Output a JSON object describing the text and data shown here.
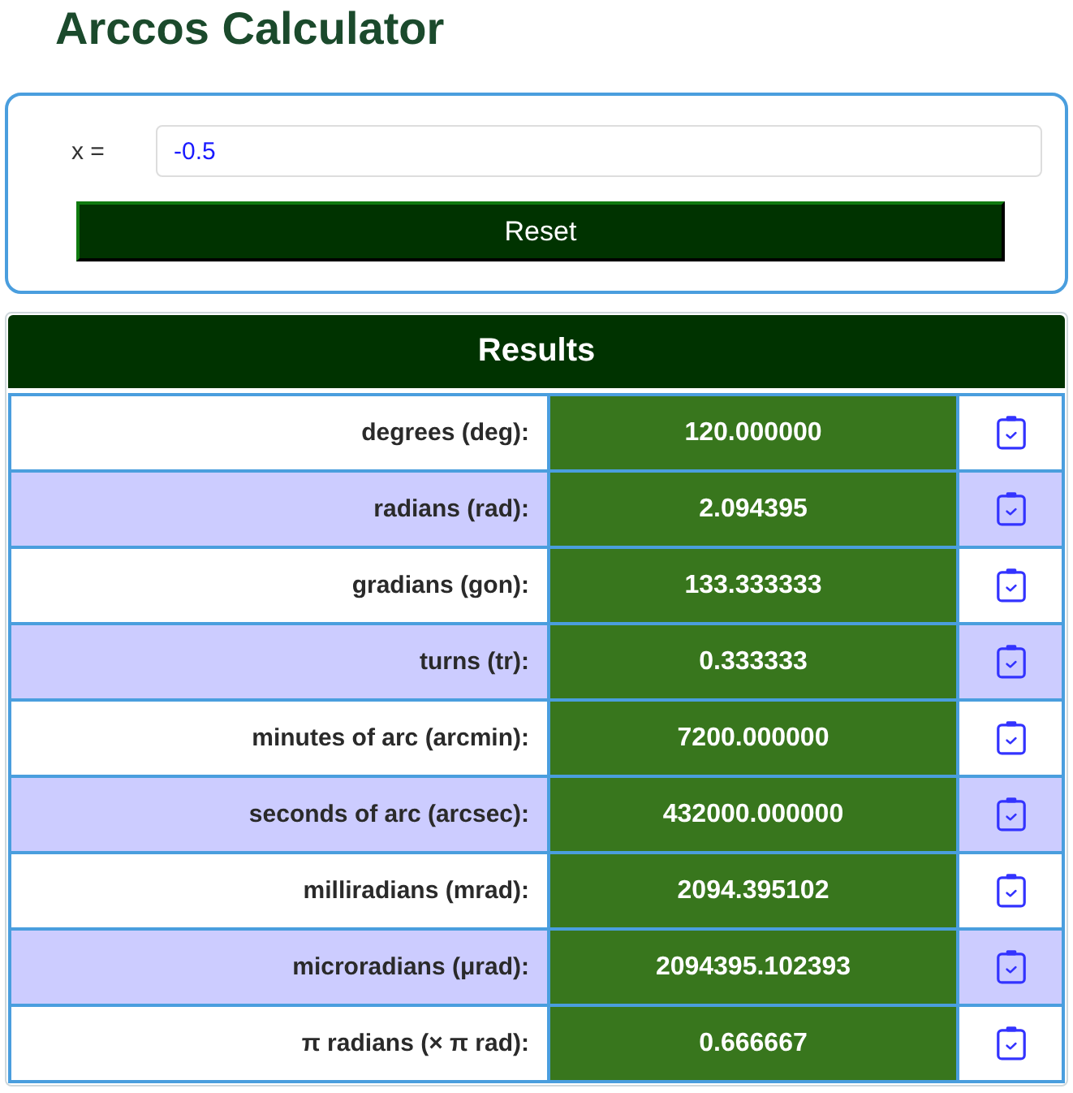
{
  "title": "Arccos Calculator",
  "input": {
    "label": "x =",
    "value": "-0.5"
  },
  "reset_button": {
    "label": "Reset"
  },
  "results": {
    "title": "Results",
    "rows": [
      {
        "label": "degrees (deg):",
        "value": "120.000000"
      },
      {
        "label": "radians (rad):",
        "value": "2.094395"
      },
      {
        "label": "gradians (gon):",
        "value": "133.333333"
      },
      {
        "label": "turns (tr):",
        "value": "0.333333"
      },
      {
        "label": "minutes of arc (arcmin):",
        "value": "7200.000000"
      },
      {
        "label": "seconds of arc (arcsec):",
        "value": "432000.000000"
      },
      {
        "label": "milliradians (mrad):",
        "value": "2094.395102"
      },
      {
        "label": "microradians (μrad):",
        "value": "2094395.102393"
      },
      {
        "label": "π radians (× π rad):",
        "value": "0.666667"
      }
    ]
  }
}
